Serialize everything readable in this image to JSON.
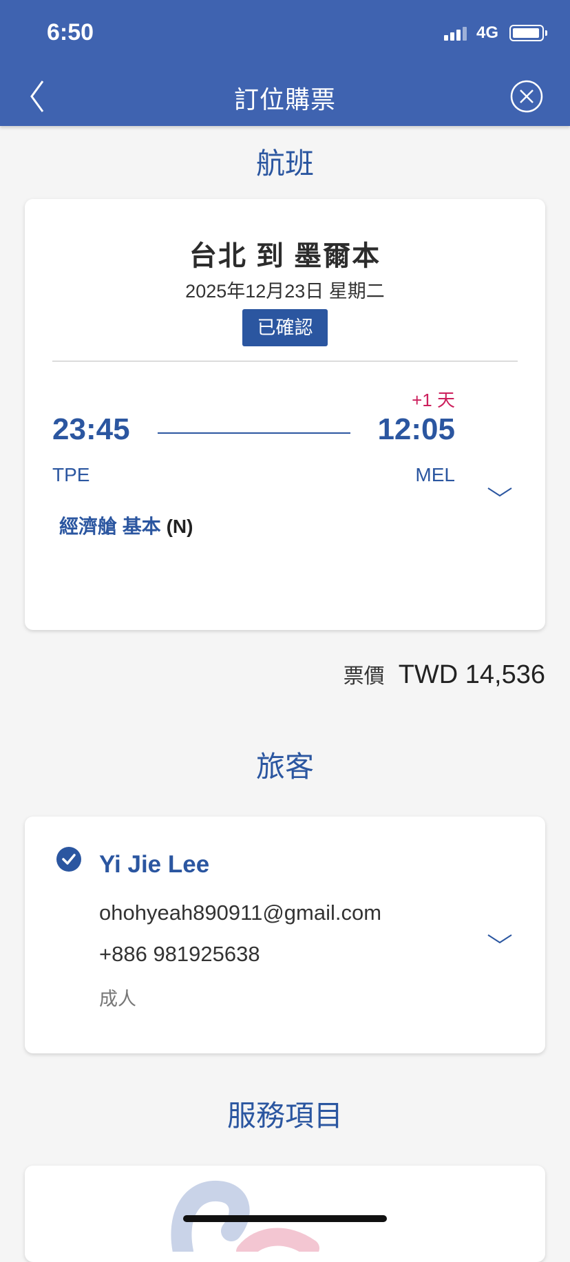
{
  "status_bar": {
    "time": "6:50",
    "network": "4G"
  },
  "nav": {
    "title": "訂位購票",
    "back_icon": "chevron-left-icon",
    "close_icon": "close-circle-icon"
  },
  "flight_section": {
    "title": "航班",
    "route": "台北 到 墨爾本",
    "date": "2025年12月23日 星期二",
    "status": "已確認",
    "departure": {
      "time": "23:45",
      "code": "TPE"
    },
    "arrival": {
      "time": "12:05",
      "code": "MEL",
      "day_offset": "+1 天"
    },
    "cabin": "經濟艙 基本",
    "fare_code": "(N)"
  },
  "price": {
    "label": "票價",
    "value": "TWD 14,536"
  },
  "passenger_section": {
    "title": "旅客",
    "name": "Yi Jie Lee",
    "email": "ohohyeah890911@gmail.com",
    "phone": "+886 981925638",
    "type": "成人"
  },
  "services_section": {
    "title": "服務項目"
  },
  "colors": {
    "header": "#3f63b0",
    "accent": "#2b56a0",
    "day_offset": "#cc1f5c",
    "background": "#f5f5f5"
  }
}
